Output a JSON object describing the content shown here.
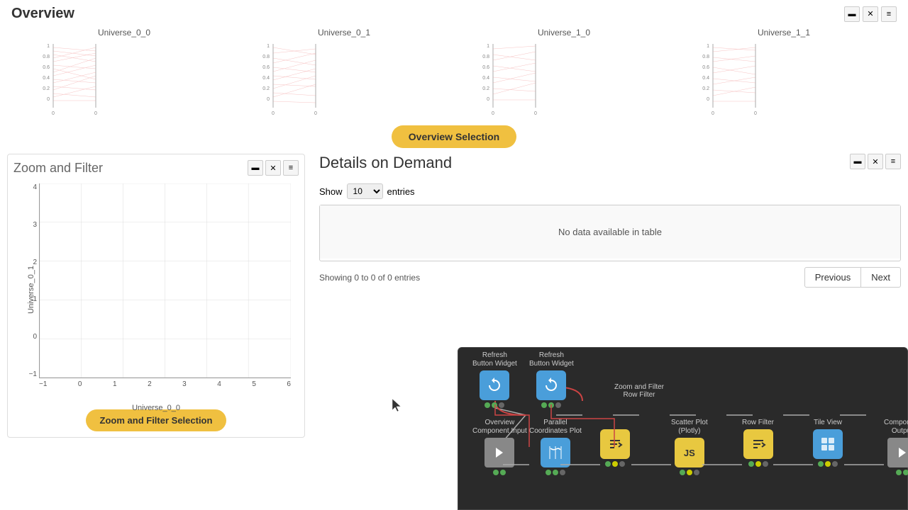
{
  "header": {
    "title": "Overview",
    "controls": [
      "minimize",
      "close",
      "menu"
    ]
  },
  "overview": {
    "universes": [
      {
        "id": "Universe_0_0"
      },
      {
        "id": "Universe_0_1"
      },
      {
        "id": "Universe_1_0"
      },
      {
        "id": "Universe_1_1"
      }
    ]
  },
  "overview_selection_btn": "Overview Selection",
  "zoom_filter": {
    "title": "Zoom and Filter",
    "x_axis_label": "Universe_0_0",
    "y_axis_label": "Universe_0_1",
    "x_ticks": [
      "-1",
      "0",
      "1",
      "2",
      "3",
      "4",
      "5",
      "6"
    ],
    "y_ticks": [
      "4",
      "3",
      "2",
      "1",
      "0",
      "-1"
    ],
    "selection_btn": "Zoom and Filter Selection"
  },
  "details": {
    "title": "Details on Demand",
    "show_label": "Show",
    "entries_label": "entries",
    "empty_message": "No data available in table",
    "showing_text": "Showing 0 to 0 of 0 entries",
    "pagination": {
      "previous": "Previous",
      "next": "Next"
    }
  },
  "flow": {
    "nodes": [
      {
        "id": "refresh1",
        "label": "Refresh\nButton Widget",
        "type": "blue",
        "icon": "↻",
        "dots": [
          "green",
          "green",
          "gray"
        ]
      },
      {
        "id": "refresh2",
        "label": "Refresh\nButton Widget",
        "type": "blue",
        "icon": "↻",
        "dots": [
          "green",
          "green",
          "gray"
        ]
      },
      {
        "id": "overview_input",
        "label": "Overview\nComponent Input",
        "type": "gray",
        "icon": "▶",
        "dots": [
          "green",
          "green"
        ]
      },
      {
        "id": "parallel",
        "label": "Parallel\nCoordinates Plot",
        "type": "blue",
        "icon": "⛰",
        "dots": [
          "green",
          "green",
          "gray"
        ]
      },
      {
        "id": "zoom_row_filter",
        "label": "Zoom and Filter\nRow Filter",
        "type": "yellow",
        "icon": "⇒",
        "dots": [
          "green",
          "yellow",
          "gray"
        ]
      },
      {
        "id": "scatter",
        "label": "Scatter Plot\n(Plotly)",
        "type": "yellow",
        "icon": "JS",
        "dots": [
          "green",
          "yellow",
          "gray"
        ]
      },
      {
        "id": "row_filter",
        "label": "Row Filter",
        "type": "yellow",
        "icon": "⇒",
        "dots": [
          "green",
          "yellow",
          "gray"
        ]
      },
      {
        "id": "tile_view",
        "label": "Tile View",
        "type": "blue",
        "icon": "⊞",
        "dots": [
          "green",
          "green",
          "gray"
        ]
      },
      {
        "id": "comp_output",
        "label": "Component Output",
        "type": "gray",
        "icon": "▶",
        "dots": [
          "green",
          "green"
        ]
      }
    ]
  }
}
